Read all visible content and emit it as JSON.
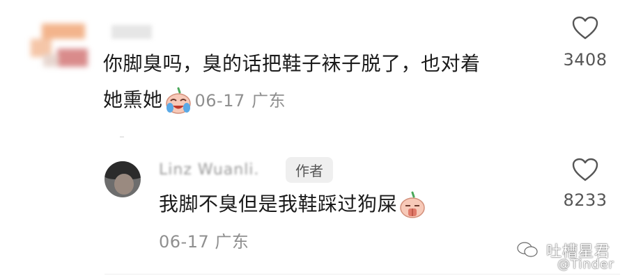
{
  "top_comment": {
    "username": "",
    "text_line1": "你脚臭吗，臭的话把鞋子袜子脱了，也对着",
    "text_line2": "她熏她",
    "date": "06-17",
    "location": "广东",
    "likes": "3408"
  },
  "reply": {
    "username": "Linz Wuanli.",
    "badge": "作者",
    "text": "我脚不臭但是我鞋踩过狗屎",
    "date": "06-17",
    "location": "广东",
    "likes": "8233"
  },
  "watermark": {
    "line1": "吐槽星君",
    "line2": "@Tinder"
  }
}
